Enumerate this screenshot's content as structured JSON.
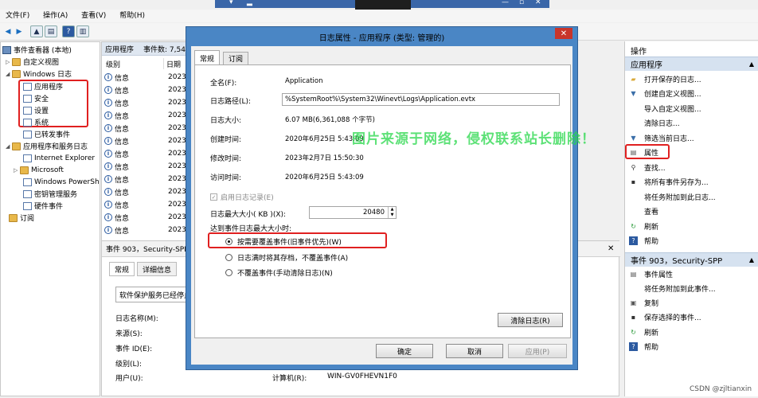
{
  "menu": [
    "文件(F)",
    "操作(A)",
    "查看(V)",
    "帮助(H)"
  ],
  "tree": {
    "root": "事件查看器 (本地)",
    "custom_views": "自定义视图",
    "windows_logs": "Windows 日志",
    "logs": [
      "应用程序",
      "安全",
      "设置",
      "系统"
    ],
    "forwarded": "已转发事件",
    "apps_services": "应用程序和服务日志",
    "sub": [
      "Internet Explorer",
      "Microsoft",
      "Windows PowerSh",
      "密钥管理服务",
      "硬件事件"
    ],
    "subscriptions": "订阅"
  },
  "center": {
    "head_title": "应用程序",
    "head_count": "事件数: 7,54",
    "col_level": "级别",
    "col_date": "日期",
    "rows": [
      {
        "level": "信息",
        "date": "2023/"
      },
      {
        "level": "信息",
        "date": "2023/"
      },
      {
        "level": "信息",
        "date": "2023/"
      },
      {
        "level": "信息",
        "date": "2023/"
      },
      {
        "level": "信息",
        "date": "2023/"
      },
      {
        "level": "信息",
        "date": "2023/"
      },
      {
        "level": "信息",
        "date": "2023/"
      },
      {
        "level": "信息",
        "date": "2023/"
      },
      {
        "level": "信息",
        "date": "2023/"
      },
      {
        "level": "信息",
        "date": "2023/"
      },
      {
        "level": "信息",
        "date": "2023/"
      },
      {
        "level": "信息",
        "date": "2023/"
      },
      {
        "level": "信息",
        "date": "2023/"
      }
    ]
  },
  "detail": {
    "title": "事件 903，Security-SPP",
    "tab_general": "常规",
    "tab_details": "详细信息",
    "message": "软件保护服务已经停止",
    "labels": [
      "日志名称(M):",
      "来源(S):",
      "事件 ID(E):",
      "级别(L):",
      "用户(U):"
    ],
    "computer_label": "计算机(R):",
    "computer_value": "WIN-GV0FHEVN1F0"
  },
  "actions": {
    "header": "操作",
    "section1": "应用程序",
    "items1": [
      "打开保存的日志...",
      "创建自定义视图...",
      "导入自定义视图...",
      "清除日志...",
      "筛选当前日志...",
      "属性",
      "查找...",
      "将所有事件另存为...",
      "将任务附加到此日志...",
      "查看",
      "刷新",
      "帮助"
    ],
    "section2": "事件 903，Security-SPP",
    "items2": [
      "事件属性",
      "将任务附加到此事件...",
      "复制",
      "保存选择的事件...",
      "刷新",
      "帮助"
    ]
  },
  "dialog": {
    "title": "日志属性 - 应用程序 (类型: 管理的)",
    "close": "✕",
    "tab_general": "常规",
    "tab_subscriptions": "订阅",
    "full_name_label": "全名(F):",
    "full_name": "Application",
    "path_label": "日志路径(L):",
    "path": "%SystemRoot%\\System32\\Winevt\\Logs\\Application.evtx",
    "size_label": "日志大小:",
    "size": "6.07 MB(6,361,088 个字节)",
    "created_label": "创建时间:",
    "created": "2020年6月25日 5:43:09",
    "modified_label": "修改时间:",
    "modified": "2023年2月7日 15:50:30",
    "accessed_label": "访问时间:",
    "accessed": "2020年6月25日 5:43:09",
    "enable_label": "启用日志记录(E)",
    "max_size_label": "日志最大大小( KB )(X):",
    "max_size": "20480",
    "when_full_label": "达到事件日志最大大小时:",
    "radios": [
      "按需要覆盖事件(旧事件优先)(W)",
      "日志满时将其存档，不覆盖事件(A)",
      "不覆盖事件(手动清除日志)(N)"
    ],
    "clear_button": "清除日志(R)",
    "ok": "确定",
    "cancel": "取消",
    "apply": "应用(P)"
  },
  "watermark": "图片来源于网络，侵权联系站长删除！",
  "credit": "CSDN @zjltianxin"
}
